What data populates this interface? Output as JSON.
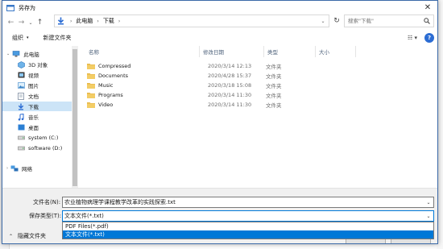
{
  "dialog": {
    "title": "另存为",
    "close_glyph": "✕"
  },
  "nav": {
    "back": "←",
    "forward": "→",
    "recent": "⌄",
    "up": "↑",
    "refresh": "↻",
    "address": [
      "此电脑",
      "下载"
    ],
    "address_sep": "›",
    "address_drop": "⌄",
    "search_placeholder": "搜索\"下载\""
  },
  "toolbar": {
    "organize": "组织",
    "new_folder": "新建文件夹",
    "caret": "▾",
    "view_glyph": "☷ ▾",
    "help": "?"
  },
  "sidebar": {
    "items": [
      {
        "label": "此电脑",
        "icon": "pc-icon"
      },
      {
        "label": "3D 对象",
        "icon": "cube-icon"
      },
      {
        "label": "视频",
        "icon": "video-icon"
      },
      {
        "label": "图片",
        "icon": "picture-icon"
      },
      {
        "label": "文档",
        "icon": "document-icon"
      },
      {
        "label": "下载",
        "icon": "download-icon",
        "selected": true
      },
      {
        "label": "音乐",
        "icon": "music-icon"
      },
      {
        "label": "桌面",
        "icon": "desktop-icon"
      },
      {
        "label": "system (C:)",
        "icon": "drive-icon"
      },
      {
        "label": "software (D:)",
        "icon": "drive-icon"
      },
      {
        "label": "网络",
        "icon": "network-icon"
      }
    ]
  },
  "columns": {
    "name": "名称",
    "date": "修改日期",
    "type": "类型",
    "size": "大小"
  },
  "files": [
    {
      "name": "Compressed",
      "date": "2020/3/14 12:13",
      "type": "文件夹"
    },
    {
      "name": "Documents",
      "date": "2020/4/28 15:37",
      "type": "文件夹"
    },
    {
      "name": "Music",
      "date": "2020/3/18 15:08",
      "type": "文件夹"
    },
    {
      "name": "Programs",
      "date": "2020/3/14 11:30",
      "type": "文件夹"
    },
    {
      "name": "Video",
      "date": "2020/3/14 11:30",
      "type": "文件夹"
    }
  ],
  "form": {
    "filename_label": "文件名(N):",
    "filename_value": "农业植物病理学课程教学改革的实践探索.txt",
    "type_label": "保存类型(T):",
    "type_value": "文本文件(*.txt)",
    "type_options": [
      "PDF Files(*.pdf)",
      "文本文件(*.txt)"
    ],
    "hide_folders": "隐藏文件夹",
    "hide_chevron": "⌃",
    "drop_glyph": "⌄"
  },
  "colors": {
    "folder": "#e8b84a",
    "selection": "#cce4f7",
    "accent": "#0078d7"
  }
}
